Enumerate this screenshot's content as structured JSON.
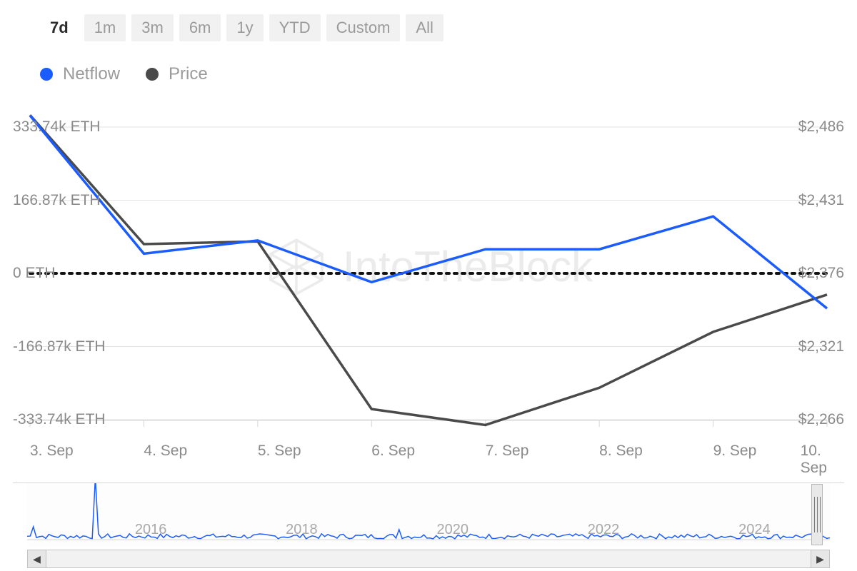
{
  "range_tabs": [
    {
      "label": "7d",
      "active": true
    },
    {
      "label": "1m",
      "active": false
    },
    {
      "label": "3m",
      "active": false
    },
    {
      "label": "6m",
      "active": false
    },
    {
      "label": "1y",
      "active": false
    },
    {
      "label": "YTD",
      "active": false
    },
    {
      "label": "Custom",
      "active": false
    },
    {
      "label": "All",
      "active": false
    }
  ],
  "legend": {
    "series1": "Netflow",
    "series2": "Price",
    "color1": "#1b5cff",
    "color2": "#4a4a4a"
  },
  "watermark_text": "IntoTheBlock",
  "y_left_ticks": [
    "333.74k ETH",
    "166.87k ETH",
    "0 ETH",
    "-166.87k ETH",
    "-333.74k ETH"
  ],
  "y_right_ticks": [
    "$2,486",
    "$2,431",
    "$2,376",
    "$2,321",
    "$2,266"
  ],
  "x_ticks": [
    "3. Sep",
    "4. Sep",
    "5. Sep",
    "6. Sep",
    "7. Sep",
    "8. Sep",
    "9. Sep",
    "10. Sep"
  ],
  "nav_years": [
    "2016",
    "2018",
    "2020",
    "2022",
    "2024"
  ],
  "chart_data": {
    "type": "line",
    "x": [
      "3. Sep",
      "4. Sep",
      "5. Sep",
      "6. Sep",
      "7. Sep",
      "8. Sep",
      "9. Sep",
      "10. Sep"
    ],
    "series": [
      {
        "name": "Netflow",
        "unit": "ETH",
        "values_k": [
          360,
          45,
          75,
          -20,
          55,
          55,
          130,
          -80
        ]
      },
      {
        "name": "Price",
        "unit": "USD",
        "values": [
          2495,
          2398,
          2400,
          2274,
          2262,
          2290,
          2332,
          2360
        ]
      }
    ],
    "y_left": {
      "label": "Netflow",
      "unit": "k ETH",
      "min": -333.74,
      "max": 333.74
    },
    "y_right": {
      "label": "Price",
      "unit": "USD",
      "min": 2266,
      "max": 2486
    },
    "zero_line": 0,
    "title": "",
    "xlabel": "",
    "ylabel": ""
  }
}
